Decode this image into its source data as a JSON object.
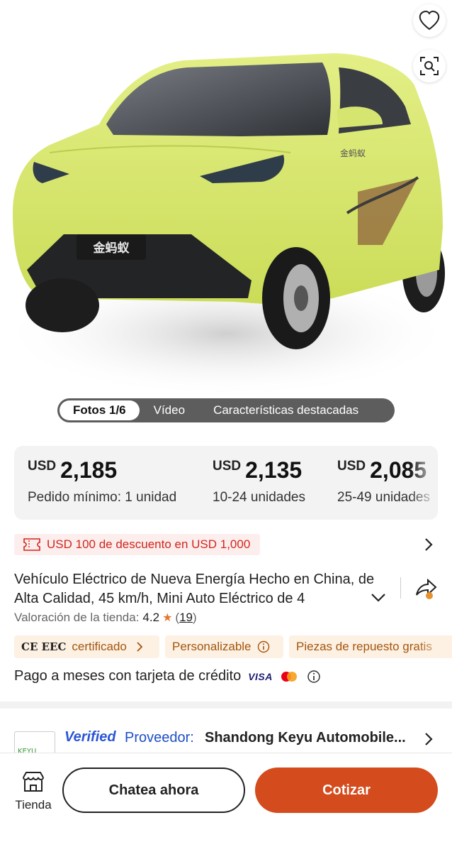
{
  "hero": {
    "brand_badge": "金蚂蚁",
    "side_badge": "金蚂蚁",
    "media_tabs": [
      {
        "label": "Fotos 1/6",
        "active": true
      },
      {
        "label": "Vídeo",
        "active": false
      },
      {
        "label": "Características destacadas",
        "active": false
      }
    ],
    "icons": [
      "heart-icon",
      "image-search-icon"
    ],
    "car_color": "#d8e86a"
  },
  "pricing": {
    "tiers": [
      {
        "currency": "USD",
        "price": "2,185",
        "qty": "Pedido mínimo: 1 unidad"
      },
      {
        "currency": "USD",
        "price": "2,135",
        "qty": "10-24 unidades"
      },
      {
        "currency": "USD",
        "price": "2,085",
        "qty": "25-49 unidades"
      }
    ]
  },
  "discount": {
    "text": "USD 100 de descuento en USD 1,000",
    "color": "#d0261c"
  },
  "product": {
    "title": "Vehículo Eléctrico de Nueva Energía Hecho en China, de Alta Calidad, 45 km/h, Mini Auto Eléctrico de 4",
    "rating_label": "Valoración de la tienda:",
    "rating_value": "4.2",
    "rating_count": "19"
  },
  "tags": [
    {
      "mark": "CE EEC",
      "label": "certificado"
    },
    {
      "label": "Personalizable"
    },
    {
      "label": "Piezas de repuesto gratis"
    }
  ],
  "payment": {
    "text": "Pago a meses con tarjeta de crédito",
    "card_visa": "VISA"
  },
  "supplier": {
    "verified": "Verified",
    "provider_label": "Proveedor:",
    "name": "Shandong Keyu Automobile..."
  },
  "bottom": {
    "store_label": "Tienda",
    "chat_label": "Chatea ahora",
    "quote_label": "Cotizar",
    "accent": "#d44b1d"
  }
}
